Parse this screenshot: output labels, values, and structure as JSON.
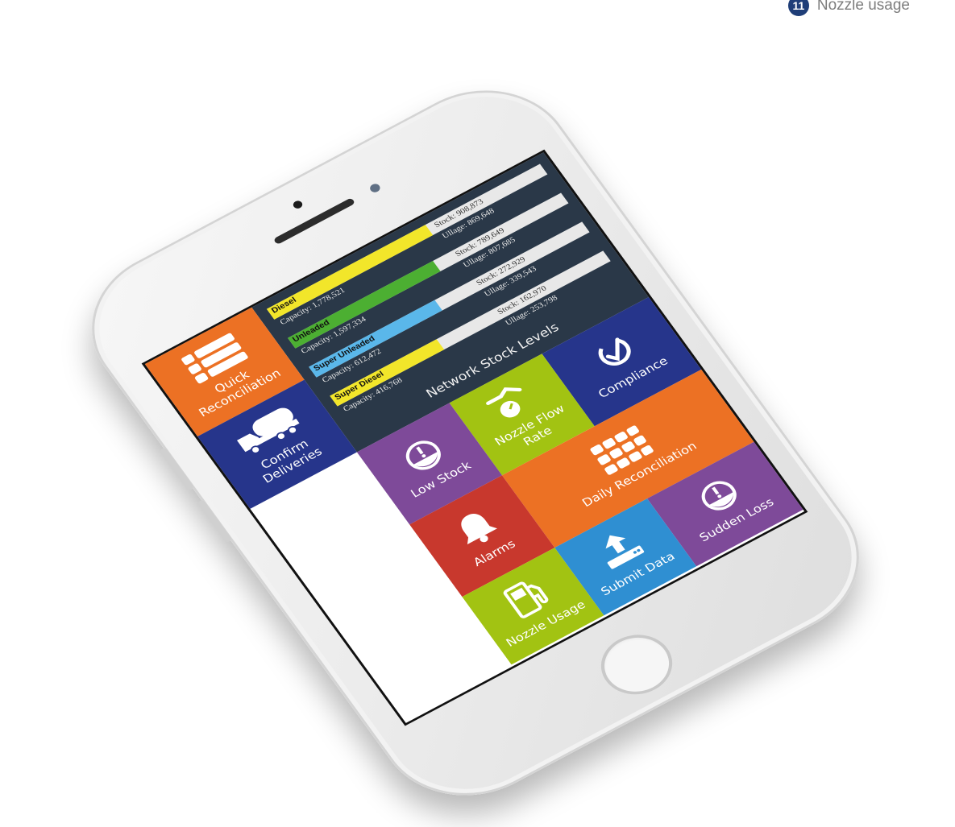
{
  "caption": {
    "badge": "11",
    "text": "Nozzle usage"
  },
  "stock_panel": {
    "title": "Network Stock Levels",
    "fuels": [
      {
        "name": "Diesel",
        "color": "#f2e62a",
        "fill_fraction": 0.58,
        "stock": "Stock: 908,873",
        "capacity": "Capacity: 1,778,521",
        "ullage": "Ullage: 869,648"
      },
      {
        "name": "Unleaded",
        "color": "#4caf32",
        "fill_fraction": 0.53,
        "stock": "Stock: 789,649",
        "capacity": "Capacity: 1,597,334",
        "ullage": "Ullage: 807,685"
      },
      {
        "name": "Super Unleaded",
        "color": "#5ab7ea",
        "fill_fraction": 0.46,
        "stock": "Stock: 272,929",
        "capacity": "Capacity: 612,472",
        "ullage": "Ullage: 339,543"
      },
      {
        "name": "Super Diesel",
        "color": "#f2e62a",
        "fill_fraction": 0.39,
        "stock": "Stock: 162,970",
        "capacity": "Capacity: 416,768",
        "ullage": "Ullage: 253,798"
      }
    ]
  },
  "tiles": {
    "quick_reconciliation": "Quick Reconciliation",
    "confirm_deliveries": "Confirm Deliveries",
    "compliance": "Compliance",
    "nozzle_flow_rate": "Nozzle Flow Rate",
    "low_stock": "Low Stock",
    "daily_reconciliation": "Daily Reconciliation",
    "alarms": "Alarms",
    "sudden_loss": "Sudden Loss",
    "submit_data": "Submit Data",
    "nozzle_usage": "Nozzle Usage"
  },
  "colors": {
    "orange": "#ec7124",
    "navy": "#26358b",
    "lime": "#a2c312",
    "purple": "#7e4a99",
    "red": "#c8382d",
    "blue": "#2f8fd2",
    "panel": "#2a3848"
  }
}
